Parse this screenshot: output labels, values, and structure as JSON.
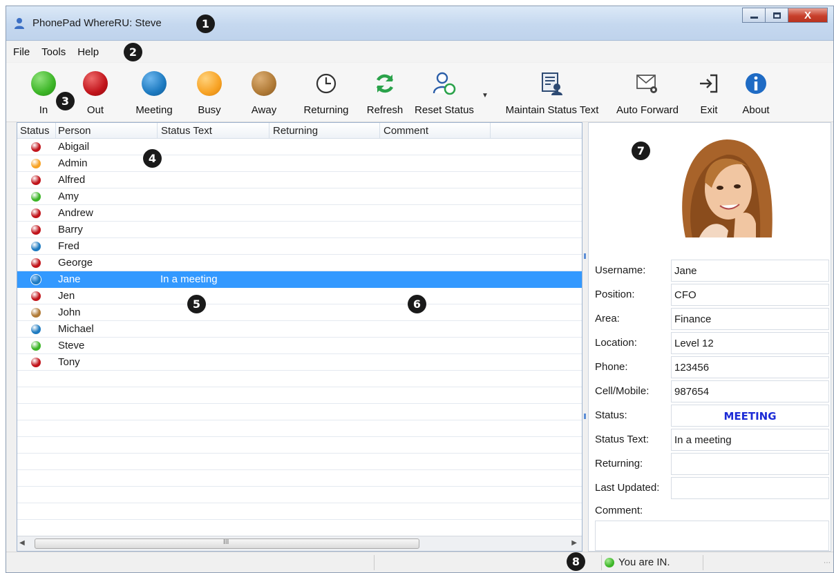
{
  "window": {
    "title": "PhonePad WhereRU: Steve",
    "close_label": "X"
  },
  "menu": [
    "File",
    "Tools",
    "Help"
  ],
  "toolbar": [
    {
      "label": "In",
      "icon": "green-ball-icon",
      "color": "#3cb527"
    },
    {
      "label": "Out",
      "icon": "red-ball-icon",
      "color": "#c1141b"
    },
    {
      "label": "Meeting",
      "icon": "blue-ball-icon",
      "color": "#1d7ac0"
    },
    {
      "label": "Busy",
      "icon": "orange-ball-icon",
      "color": "#f7a224"
    },
    {
      "label": "Away",
      "icon": "brown-ball-icon",
      "color": "#b07a36"
    },
    {
      "label": "Returning",
      "icon": "clock-icon"
    },
    {
      "label": "Refresh",
      "icon": "refresh-icon"
    },
    {
      "label": "Reset Status",
      "icon": "reset-status-icon"
    },
    {
      "label": "Maintain Status Text",
      "icon": "maintain-status-text-icon"
    },
    {
      "label": "Auto Forward",
      "icon": "auto-forward-icon"
    },
    {
      "label": "Exit",
      "icon": "exit-icon"
    },
    {
      "label": "About",
      "icon": "info-icon"
    }
  ],
  "list": {
    "columns": [
      "Status",
      "Person",
      "Status Text",
      "Returning",
      "Comment"
    ],
    "rows": [
      {
        "person": "Abigail",
        "status_color": "#c1141b",
        "status_text": ""
      },
      {
        "person": "Admin",
        "status_color": "#f7a224",
        "status_text": ""
      },
      {
        "person": "Alfred",
        "status_color": "#c1141b",
        "status_text": ""
      },
      {
        "person": "Amy",
        "status_color": "#3cb527",
        "status_text": ""
      },
      {
        "person": "Andrew",
        "status_color": "#c1141b",
        "status_text": ""
      },
      {
        "person": "Barry",
        "status_color": "#c1141b",
        "status_text": ""
      },
      {
        "person": "Fred",
        "status_color": "#1d7ac0",
        "status_text": ""
      },
      {
        "person": "George",
        "status_color": "#c1141b",
        "status_text": ""
      },
      {
        "person": "Jane",
        "status_color": "#1d7ac0",
        "status_text": "In a meeting",
        "selected": true
      },
      {
        "person": "Jen",
        "status_color": "#c1141b",
        "status_text": ""
      },
      {
        "person": "John",
        "status_color": "#b07a36",
        "status_text": ""
      },
      {
        "person": "Michael",
        "status_color": "#1d7ac0",
        "status_text": ""
      },
      {
        "person": "Steve",
        "status_color": "#3cb527",
        "status_text": ""
      },
      {
        "person": "Tony",
        "status_color": "#c1141b",
        "status_text": ""
      }
    ],
    "scroll_grip": "III"
  },
  "details": {
    "fields": [
      {
        "label": "Username:",
        "value": "Jane"
      },
      {
        "label": "Position:",
        "value": "CFO"
      },
      {
        "label": "Area:",
        "value": "Finance"
      },
      {
        "label": "Location:",
        "value": "Level 12"
      },
      {
        "label": "Phone:",
        "value": "123456"
      },
      {
        "label": "Cell/Mobile:",
        "value": "987654"
      },
      {
        "label": "Status:",
        "value": "MEETING"
      },
      {
        "label": "Status Text:",
        "value": "In a meeting"
      },
      {
        "label": "Returning:",
        "value": ""
      },
      {
        "label": "Last Updated:",
        "value": ""
      }
    ],
    "comment_label": "Comment:",
    "status_color": "#1c2bd6"
  },
  "statusbar": {
    "text": "You are IN.",
    "indicator_color": "#3cb527"
  },
  "callouts": [
    "1",
    "2",
    "3",
    "4",
    "5",
    "6",
    "7",
    "8"
  ]
}
